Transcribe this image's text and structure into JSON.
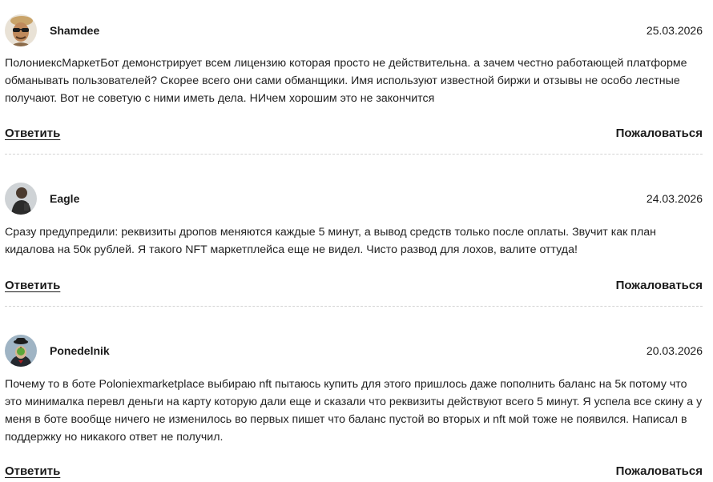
{
  "comments": [
    {
      "author": "Shamdee",
      "date": "25.03.2026",
      "avatar": "avatar-sunglasses-man",
      "text": "ПолониексМаркетБот демонстрирует всем лицензию которая просто не действительна. а зачем честно работающей платформе обманывать пользователей? Скорее всего они сами обманщики. Имя используют известной биржи и отзывы не особо лестные получают. Вот не советую с ними иметь дела. НИчем хорошим это не закончится",
      "reply_label": "Ответить",
      "report_label": "Пожаловаться"
    },
    {
      "author": "Eagle",
      "date": "24.03.2026",
      "avatar": "avatar-dark-figure",
      "text": "Сразу предупредили: реквизиты дропов меняются каждые 5 минут, а вывод средств только после оплаты. Звучит как план кидалова на 50к рублей. Я такого NFT маркетплейса еще не видел. Чисто развод для лохов, валите оттуда!",
      "reply_label": "Ответить",
      "report_label": "Пожаловаться"
    },
    {
      "author": "Ponedelnik",
      "date": "20.03.2026",
      "avatar": "avatar-bowler-hat-apple",
      "text": "Почему то в боте Poloniexmarketplace выбираю nft пытаюсь купить для этого пришлось даже пополнить баланс на 5к потому что это минималка перевл деньги на карту которую дали еще и сказали что реквизиты действуют всего 5 минут. Я успела все скину а у меня в боте вообще ничего не изменилось во первых пишет что баланс пустой во вторых и nft мой тоже не появился. Написал в поддержку но никакого ответ не получил.",
      "reply_label": "Ответить",
      "report_label": "Пожаловаться"
    }
  ]
}
